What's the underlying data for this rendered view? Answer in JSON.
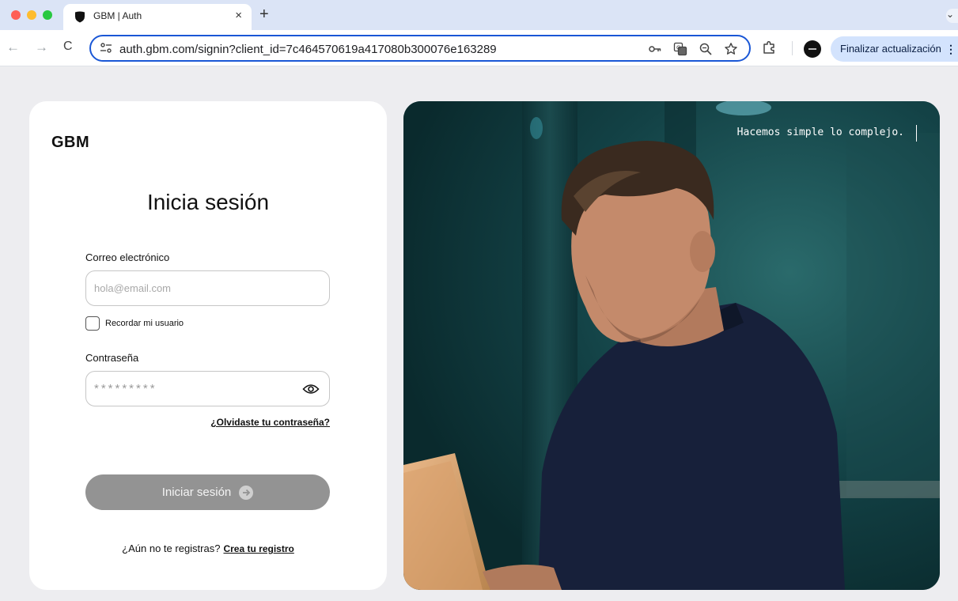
{
  "browser": {
    "tab_title": "GBM | Auth",
    "tab_close": "×",
    "new_tab": "+",
    "tab_menu": "⌄",
    "nav_back": "←",
    "nav_forward": "→",
    "nav_reload": "C",
    "url": "auth.gbm.com/signin?client_id=7c464570619a417080b300076e163289",
    "update_button": "Finalizar actualización",
    "menu": "⋮"
  },
  "login": {
    "logo": "GBM",
    "title": "Inicia sesión",
    "email_label": "Correo electrónico",
    "email_placeholder": "hola@email.com",
    "remember_label": "Recordar mi usuario",
    "password_label": "Contraseña",
    "password_placeholder": "*********",
    "forgot_link": "¿Olvidaste tu contraseña?",
    "submit_label": "Iniciar sesión",
    "register_prompt": "¿Aún no te registras?",
    "register_link": "Crea tu registro"
  },
  "hero": {
    "tagline": "Hacemos simple lo complejo."
  },
  "colors": {
    "submit_disabled": "#939393",
    "omnibox_focus": "#1a57d6",
    "update_button_bg": "#d3e3fd"
  }
}
